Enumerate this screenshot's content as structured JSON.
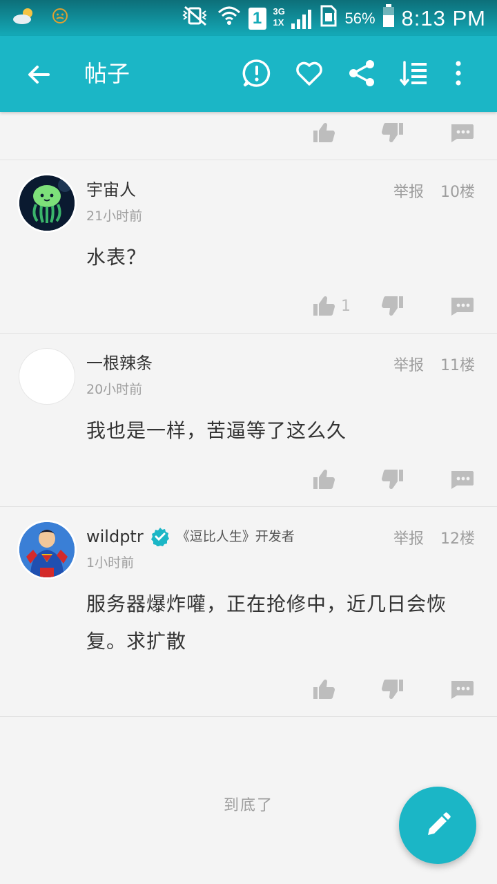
{
  "status_bar": {
    "battery_percent": "56%",
    "time": "8:13 PM",
    "sim_slot": "1",
    "network_label_top": "3G",
    "network_label_bottom": "1X"
  },
  "app_bar": {
    "title": "帖子",
    "icons": [
      "back-arrow-icon",
      "report-icon",
      "favorite-heart-icon",
      "share-icon",
      "sort-list-icon",
      "more-vert-icon"
    ]
  },
  "posts": [
    {
      "username": "宇宙人",
      "time_ago": "21小时前",
      "report_label": "举报",
      "floor": "10楼",
      "content": "水表？",
      "like_count": "1"
    },
    {
      "username": "一根辣条",
      "time_ago": "20小时前",
      "report_label": "举报",
      "floor": "11楼",
      "content": "我也是一样，苦逼等了这么久",
      "like_count": ""
    },
    {
      "username": "wildptr",
      "developer_tag": "《逗比人生》开发者",
      "time_ago": "1小时前",
      "report_label": "举报",
      "floor": "12楼",
      "content": "服务器爆炸嚾，正在抢修中，近几日会恢复。求扩散",
      "like_count": ""
    }
  ],
  "footer": {
    "end_label": "到底了"
  },
  "colors": {
    "accent": "#1bb6c6",
    "status_bar": "#0d6f79",
    "background": "#f4f4f4",
    "verified": "#1bb6c6"
  }
}
